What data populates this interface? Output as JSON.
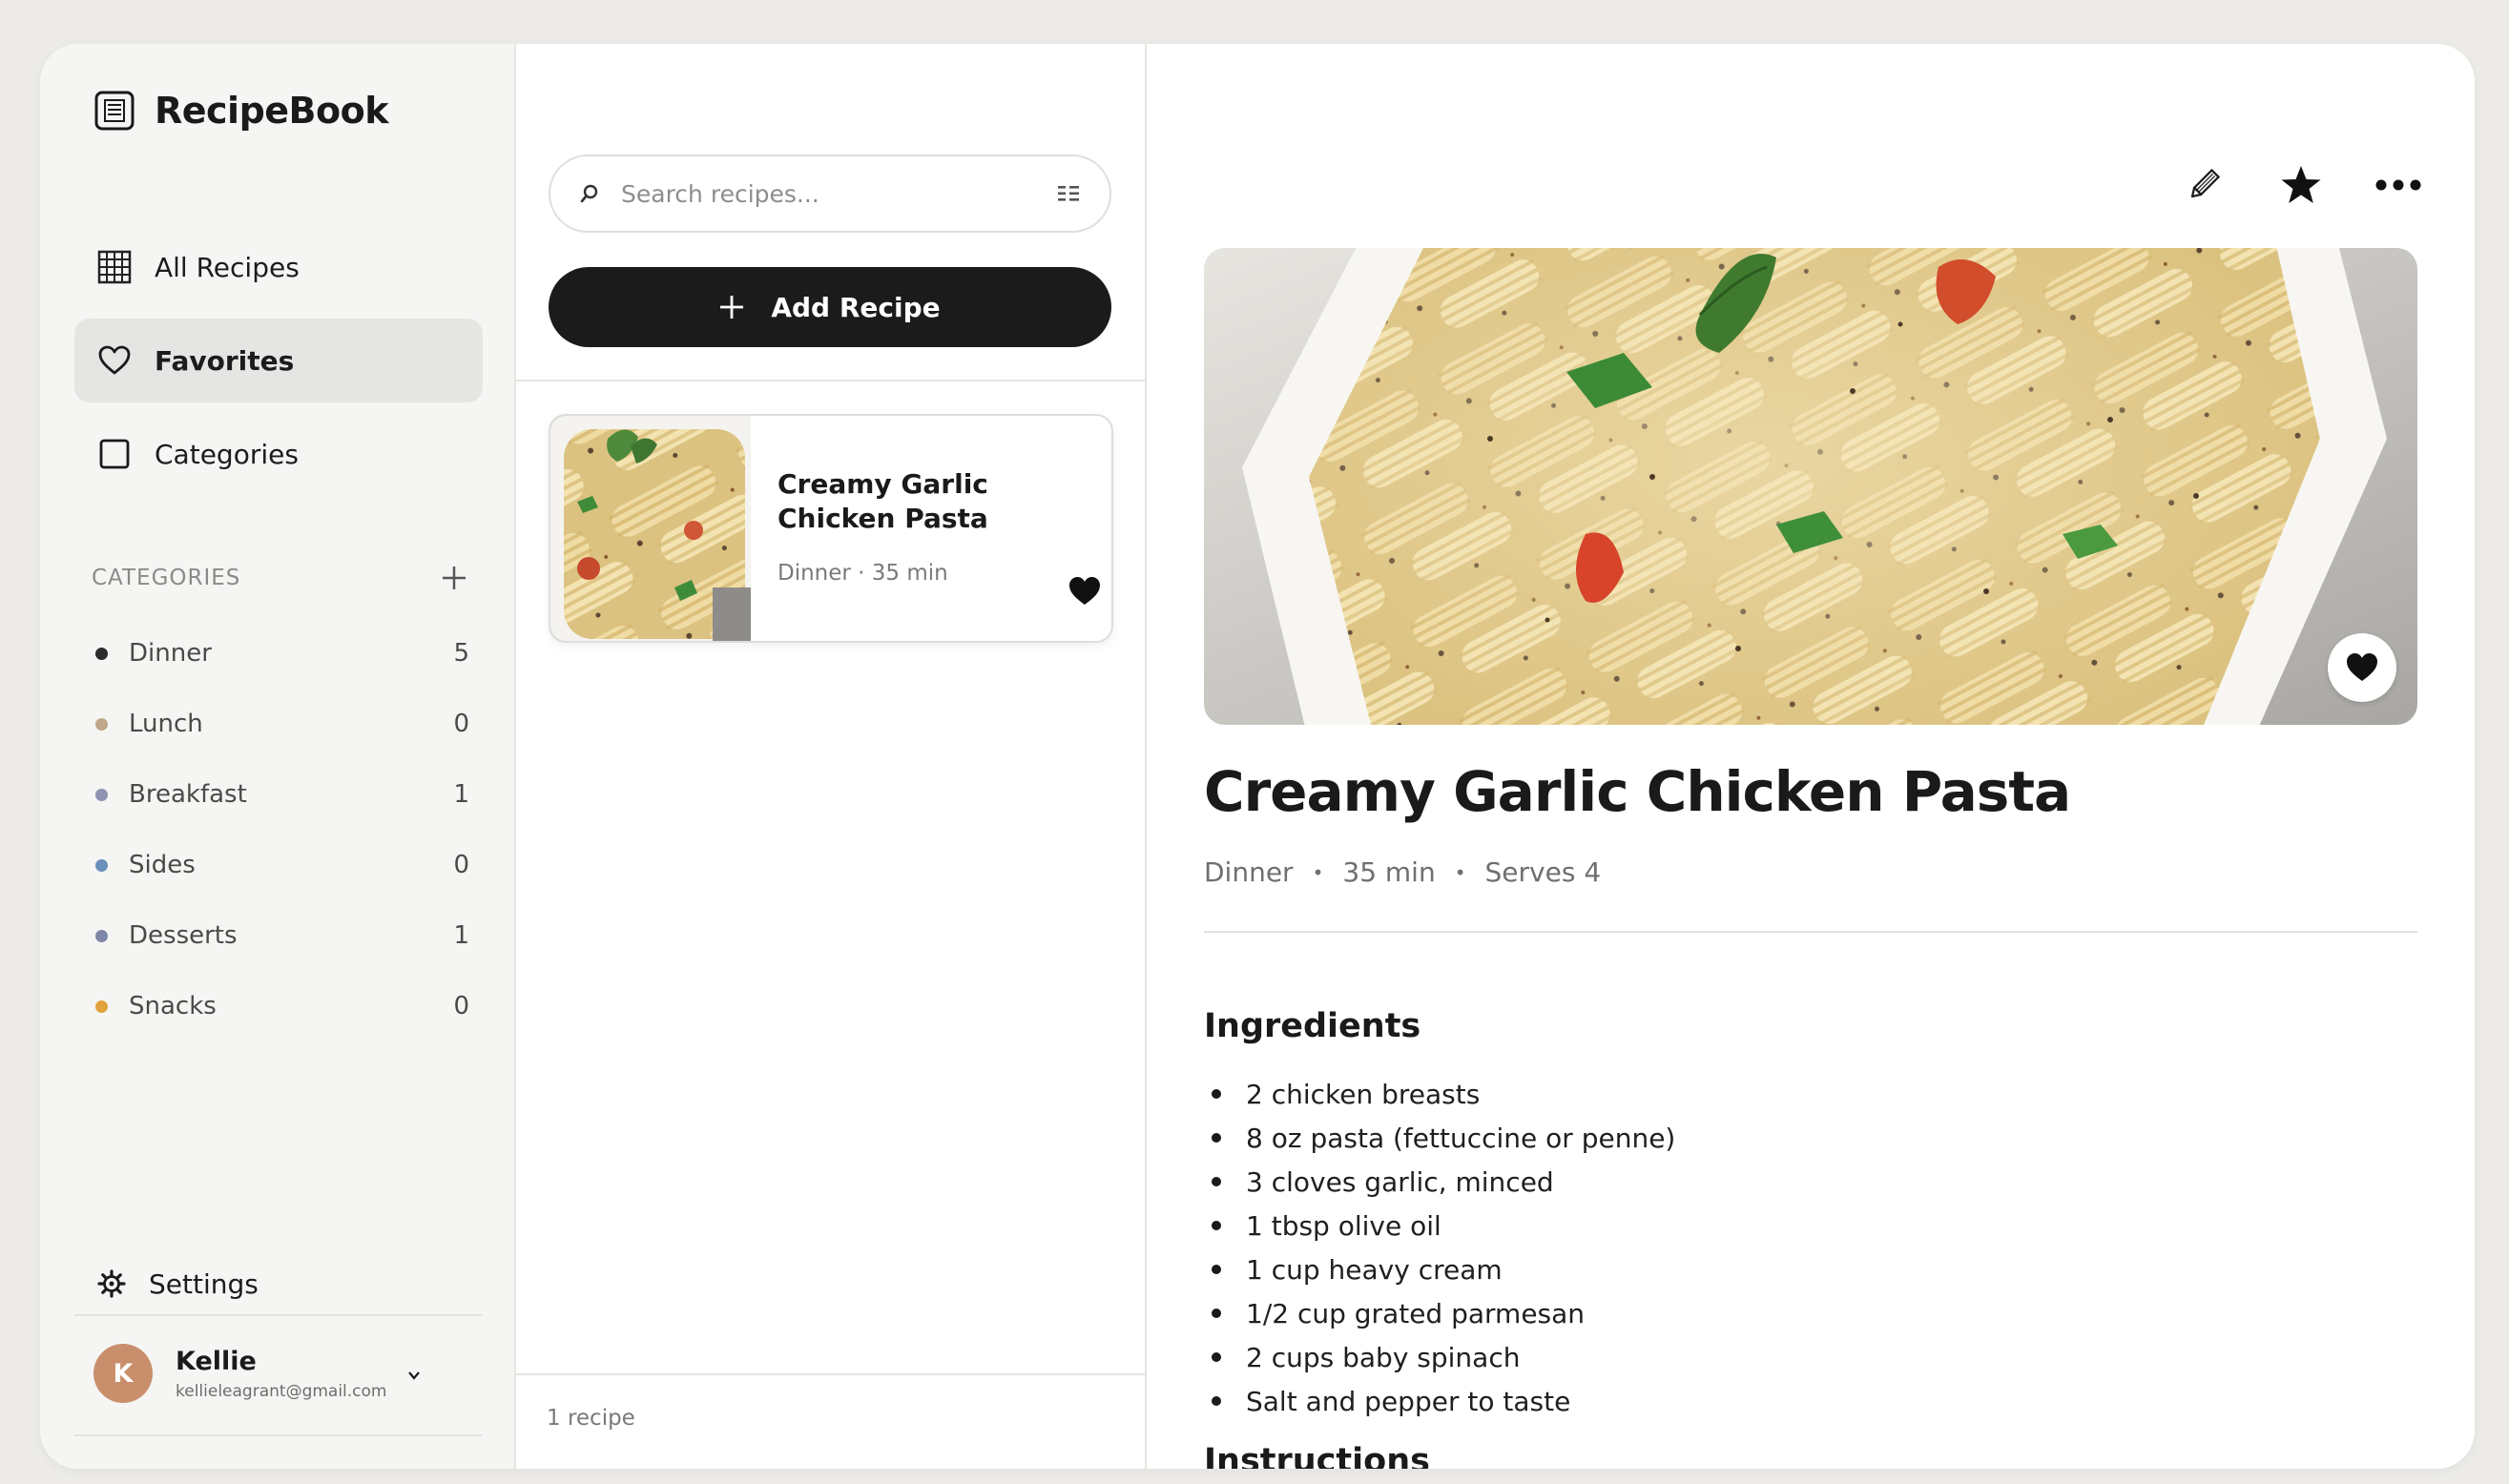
{
  "app": {
    "name": "RecipeBook"
  },
  "sidebar": {
    "nav": [
      {
        "label": "All Recipes",
        "icon": "grid-icon"
      },
      {
        "label": "Favorites",
        "icon": "heart-icon",
        "active": true
      },
      {
        "label": "Categories",
        "icon": "square-icon"
      }
    ],
    "categories_title": "CATEGORIES",
    "categories": [
      {
        "name": "Dinner",
        "count": "5",
        "color": "#2b2b2b"
      },
      {
        "name": "Lunch",
        "count": "0",
        "color": "#bfa98a"
      },
      {
        "name": "Breakfast",
        "count": "1",
        "color": "#8d93b0"
      },
      {
        "name": "Sides",
        "count": "0",
        "color": "#6a8fba"
      },
      {
        "name": "Desserts",
        "count": "1",
        "color": "#7d86a8"
      },
      {
        "name": "Snacks",
        "count": "0",
        "color": "#e0a33c"
      }
    ],
    "settings_label": "Settings",
    "user": {
      "initial": "K",
      "name": "Kellie",
      "email": "kellieleagrant@gmail.com"
    }
  },
  "list": {
    "search_placeholder": "Search recipes...",
    "add_label": "Add Recipe",
    "recipes": [
      {
        "title": "Creamy Garlic Chicken Pasta",
        "meta": "Dinner · 35 min",
        "favorite": true
      }
    ],
    "count_label": "1 recipe"
  },
  "detail": {
    "title": "Creamy Garlic Chicken Pasta",
    "category": "Dinner",
    "time": "35 min",
    "serves": "Serves 4",
    "separator": "•",
    "ingredients_title": "Ingredients",
    "ingredients": [
      "2 chicken breasts",
      "8 oz pasta (fettuccine or penne)",
      "3 cloves garlic, minced",
      "1 tbsp olive oil",
      "1 cup heavy cream",
      "1/2 cup grated parmesan",
      "2 cups baby spinach",
      "Salt and pepper to taste"
    ],
    "instructions_title": "Instructions"
  },
  "colors": {
    "accent": "#1b1b1b",
    "avatar": "#c98f6c",
    "background": "#ecebe8"
  }
}
